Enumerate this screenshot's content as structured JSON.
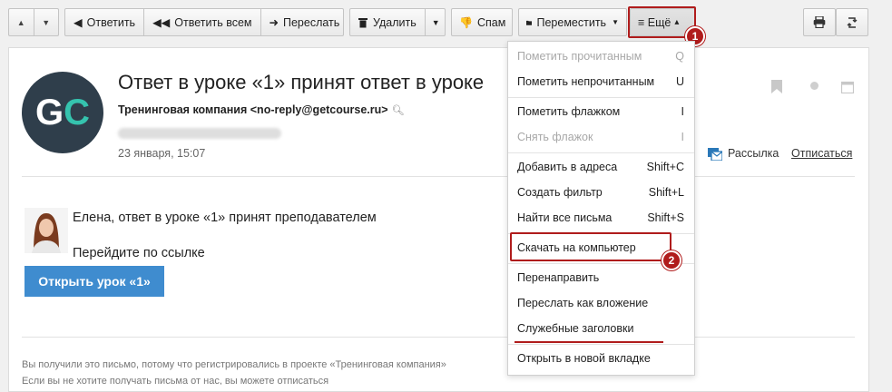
{
  "toolbar": {
    "nav_up_icon": "triangle-up-icon",
    "nav_down_icon": "triangle-down-icon",
    "reply": "Ответить",
    "reply_all": "Ответить всем",
    "forward": "Переслать",
    "delete": "Удалить",
    "spam": "Спам",
    "move": "Переместить",
    "more": "≡ Ещё",
    "more_arrow": "▴",
    "print_icon": "printer-icon",
    "refresh_icon": "refresh-icon"
  },
  "callouts": [
    "1",
    "2"
  ],
  "email": {
    "avatar_letters": [
      "G",
      "C"
    ],
    "subject": "Ответ в уроке «1» принят ответ в уроке",
    "sender": "Тренинговая компания <no-reply@getcourse.ru>",
    "date": "23 января, 15:07",
    "mailing_label": "Рассылка",
    "unsubscribe": "Отписаться",
    "greeting": "Елена, ответ в уроке «1» принят преподавателем",
    "follow_link": "Перейдите по ссылке",
    "cta": "Открыть урок «1»",
    "footer_line1": "Вы получили это письмо, потому что регистрировались в проекте «Тренинговая компания»",
    "footer_line2": "Если вы не хотите получать письма от нас, вы можете отписаться"
  },
  "menu": {
    "items": [
      {
        "label": "Пометить прочитанным",
        "shortcut": "Q",
        "disabled": true
      },
      {
        "label": "Пометить непрочитанным",
        "shortcut": "U",
        "disabled": false
      },
      {
        "label": "Пометить флажком",
        "shortcut": "I",
        "disabled": false
      },
      {
        "label": "Снять флажок",
        "shortcut": "I",
        "disabled": true
      },
      {
        "label": "Добавить в адреса",
        "shortcut": "Shift+C",
        "disabled": false
      },
      {
        "label": "Создать фильтр",
        "shortcut": "Shift+L",
        "disabled": false
      },
      {
        "label": "Найти все письма",
        "shortcut": "Shift+S",
        "disabled": false
      },
      {
        "label": "Скачать на компьютер",
        "shortcut": "",
        "disabled": false
      },
      {
        "label": "Перенаправить",
        "shortcut": "",
        "disabled": false
      },
      {
        "label": "Переслать как вложение",
        "shortcut": "",
        "disabled": false
      },
      {
        "label": "Служебные заголовки",
        "shortcut": "",
        "disabled": false
      },
      {
        "label": "Открыть в новой вкладке",
        "shortcut": "",
        "disabled": false
      }
    ]
  },
  "colors": {
    "accent_red": "#b01c1c",
    "button_blue": "#3f8ccf",
    "avatar_bg": "#2f3e4b",
    "avatar_accent": "#35c3ae"
  }
}
